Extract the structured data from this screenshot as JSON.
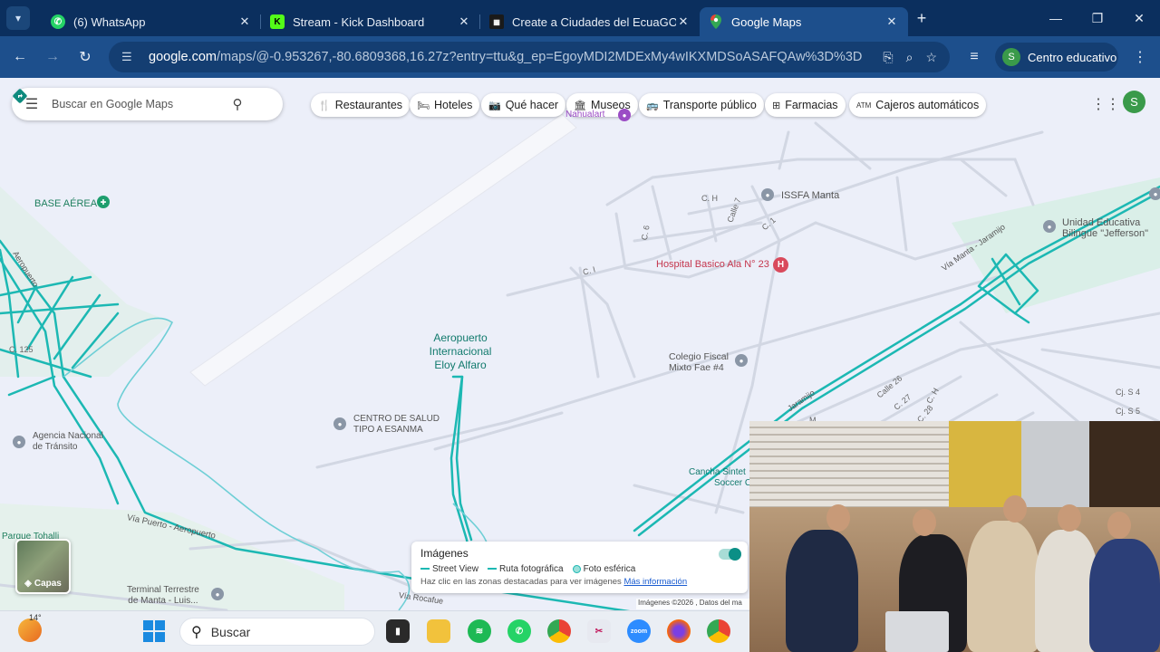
{
  "browser": {
    "tabs": [
      {
        "title": "(6) WhatsApp",
        "icon": "whatsapp-icon"
      },
      {
        "title": "Stream - Kick Dashboard",
        "icon": "kick-icon"
      },
      {
        "title": "Create a Ciudades del EcuaGOD",
        "icon": "document-icon"
      },
      {
        "title": "Google Maps",
        "icon": "google-maps-icon"
      }
    ],
    "url_host": "google.com",
    "url_path": "/maps/@-0.953267,-80.6809368,16.27z?entry=ttu&g_ep=EgoyMDI2MDExMy4wIKXMDSoASAFQAw%3D%3D",
    "profile_initial": "S",
    "profile_name": "Centro educativo"
  },
  "maps": {
    "search_placeholder": "Buscar en Google Maps",
    "account_initial": "S",
    "chips": [
      {
        "label": "Restaurantes",
        "icon": "fork-knife-icon"
      },
      {
        "label": "Hoteles",
        "icon": "bed-icon"
      },
      {
        "label": "Qué hacer",
        "icon": "camera-icon"
      },
      {
        "label": "Museos",
        "icon": "museum-icon"
      },
      {
        "label": "Transporte público",
        "icon": "bus-icon"
      },
      {
        "label": "Farmacias",
        "icon": "pharmacy-icon"
      },
      {
        "label": "Cajeros automáticos",
        "icon": "atm-icon"
      }
    ],
    "places": {
      "base_aerea": "BASE AÉREA",
      "issfa": "ISSFA Manta",
      "hospital": "Hospital Basico Ala N° 23",
      "unidad_1": "Unidad Educativa",
      "unidad_2": "Bilingüe \"Jefferson\"",
      "aeropuerto_1": "Aeropuerto",
      "aeropuerto_2": "Internacional",
      "aeropuerto_3": "Eloy Alfaro",
      "colegio_1": "Colegio Fiscal",
      "colegio_2": "Mixto Fae #4",
      "centro_1": "CENTRO DE SALUD",
      "centro_2": "TIPO A ESANMA",
      "agencia_1": "Agencia Nacional",
      "agencia_2": "de Tránsito",
      "cancha_1": "Cancha Sintet",
      "cancha_2": "Soccer C",
      "parque": "Parque Tohalli",
      "terminal_1": "Terminal Terrestre",
      "terminal_2": "de Manta - Luis...",
      "museum_partial": "Nahualart"
    },
    "streets": {
      "ch": "C. H",
      "calle7": "Calle 7",
      "c6": "C. 6",
      "c1a": "C. 1",
      "c1b": "C. I",
      "c125": "C. 125",
      "aeropuerto_road": "Aeropuerto",
      "via_manta": "Vía Manta - Jaramijo",
      "jaramijo": "Jaramijo",
      "via_puerto": "Vía Puerto - Aeropuerto",
      "via_rocafuerte": "Vía Rocafue",
      "calle26": "Calle 26",
      "c27": "C. 27",
      "c28": "C. 28",
      "ch2": "C. H",
      "cj4": "Cj. S 4",
      "cj5": "Cj. S 5",
      "m": "M"
    },
    "layers_label": "Capas",
    "imagery": {
      "title": "Imágenes",
      "legend": [
        "Street View",
        "Ruta fotográfica",
        "Foto esférica"
      ],
      "hint": "Haz clic en las zonas destacadas para ver imágenes",
      "link": "Más información"
    },
    "attribution": "Imágenes ©2026 , Datos del ma"
  },
  "taskbar": {
    "temperature": "14°",
    "search_label": "Buscar"
  },
  "colors": {
    "streetview": "#1cb8b3",
    "chrome_dark": "#0b2f5e",
    "chrome_toolbar": "#1d4f8c"
  }
}
